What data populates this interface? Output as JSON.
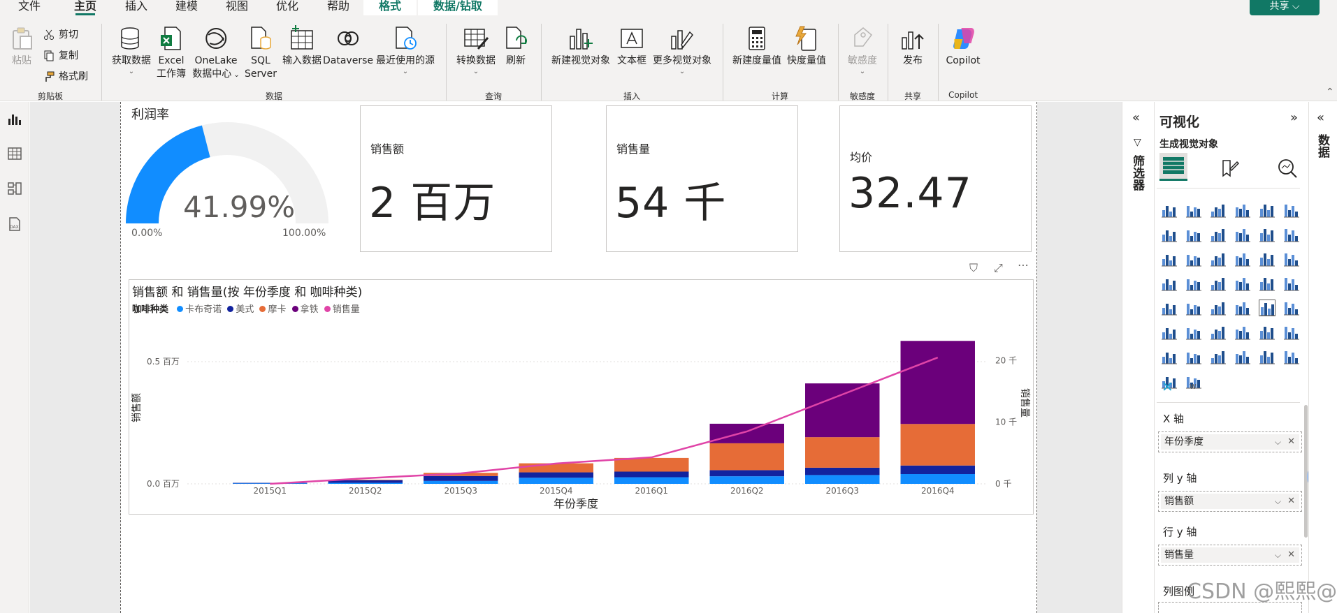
{
  "menu": {
    "tabs": [
      "文件",
      "主页",
      "插入",
      "建模",
      "视图",
      "优化",
      "帮助"
    ],
    "context_tabs": [
      "格式",
      "数据/钻取"
    ],
    "share": "共享 ⌵"
  },
  "ribbon": {
    "clipboard": {
      "paste": "粘贴",
      "cut": "剪切",
      "copy": "复制",
      "format_painter": "格式刷",
      "group": "剪贴板"
    },
    "data": {
      "get_data": "获取数据",
      "excel_1": "Excel",
      "excel_2": "工作簿",
      "onelake_1": "OneLake",
      "onelake_2": "数据中心",
      "sql_1": "SQL",
      "sql_2": "Server",
      "enter_data": "输入数据",
      "dataverse": "Dataverse",
      "recent": "最近使用的源",
      "group": "数据"
    },
    "query": {
      "transform": "转换数据",
      "refresh": "刷新",
      "group": "查询"
    },
    "insert": {
      "new_visual": "新建视觉对象",
      "textbox": "文本框",
      "more_visuals": "更多视觉对象",
      "group": "插入"
    },
    "calc": {
      "new_measure": "新建度量值",
      "quick_measure": "快度量值",
      "group": "计算"
    },
    "sensitivity": {
      "label": "敏感度",
      "group": "敏感度"
    },
    "share": {
      "publish": "发布",
      "group": "共享"
    },
    "copilot": {
      "label": "Copilot",
      "group": "Copilot"
    }
  },
  "gauge": {
    "title": "利润率",
    "value": "41.99%",
    "fraction": 0.4199,
    "min": "0.00%",
    "max": "100.00%",
    "color_fill": "#118DFF",
    "color_track": "#F1F1F1"
  },
  "cards": [
    {
      "label": "销售额",
      "value": "2 百万"
    },
    {
      "label": "销售量",
      "value": "54 千"
    },
    {
      "label": "均价",
      "value": "32.47"
    }
  ],
  "chart": {
    "title": "销售额 和 销售量(按 年份季度 和 咖啡种类)",
    "legend_title": "咖啡种类",
    "xlabel": "年份季度",
    "ylabel_left": "销售额",
    "ylabel_right": "销售量",
    "left_ticks": [
      "0.0 百万",
      "0.5 百万"
    ],
    "right_ticks": [
      "0 千",
      "10 千",
      "20 千"
    ]
  },
  "chart_data": {
    "type": "bar",
    "stacked": true,
    "categories": [
      "2015Q1",
      "2015Q2",
      "2015Q3",
      "2015Q4",
      "2016Q1",
      "2016Q2",
      "2016Q3",
      "2016Q4"
    ],
    "series": [
      {
        "name": "卡布奇诺",
        "color": "#118DFF",
        "values": [
          0.002,
          0.004,
          0.012,
          0.025,
          0.027,
          0.031,
          0.036,
          0.04
        ]
      },
      {
        "name": "美式",
        "color": "#12239E",
        "values": [
          0.002,
          0.011,
          0.02,
          0.022,
          0.023,
          0.025,
          0.03,
          0.035
        ]
      },
      {
        "name": "摩卡",
        "color": "#E66C37",
        "values": [
          0.0,
          0.002,
          0.013,
          0.037,
          0.056,
          0.11,
          0.125,
          0.17
        ]
      },
      {
        "name": "拿铁",
        "color": "#6B007B",
        "values": [
          0.0,
          0.0,
          0.0,
          0.0,
          0.0,
          0.08,
          0.22,
          0.34
        ]
      }
    ],
    "line": {
      "name": "销售量",
      "color": "#E044A7",
      "axis": "right",
      "values": [
        0.0,
        0.9,
        1.7,
        3.3,
        4.3,
        8.5,
        14.5,
        20.5
      ]
    },
    "ylim": [
      0,
      0.58
    ],
    "ylim_right": [
      0,
      23
    ],
    "grid": true,
    "legend_position": "top-left"
  },
  "filter_pane": {
    "label": "筛选器"
  },
  "viz_pane": {
    "title": "可视化",
    "subtitle": "生成视觉对象",
    "x_axis_label": "X 轴",
    "x_axis_field": "年份季度",
    "col_y_label": "列 y 轴",
    "col_y_field": "销售额",
    "row_y_label": "行 y 轴",
    "row_y_field": "销售量",
    "legend_label": "列图例"
  },
  "data_pane": {
    "label": "数据"
  },
  "watermark": "CSDN @熙熙@"
}
